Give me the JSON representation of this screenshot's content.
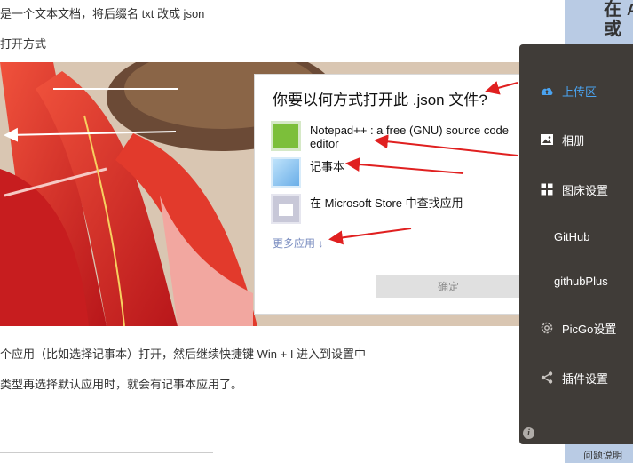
{
  "document": {
    "line1": "是一个文本文档，将后缀名 txt 改成 json",
    "line2": "打开方式",
    "line3": "个应用（比如选择记事本）打开，然后继续快捷键 Win + I 进入到设置中",
    "line4": "类型再选择默认应用时，就会有记事本应用了。"
  },
  "dialog": {
    "title": "你要以何方式打开此 .json 文件?",
    "apps": [
      {
        "name": "Notepad++ : a free (GNU) source code editor",
        "icon": "notepad-plus-plus-icon"
      },
      {
        "name": "记事本",
        "icon": "notepad-icon"
      },
      {
        "name": "在 Microsoft Store 中查找应用",
        "icon": "microsoft-store-icon"
      }
    ],
    "more_apps": "更多应用 ↓",
    "ok_button": "确定"
  },
  "sidebar": {
    "items": [
      {
        "label": "上传区",
        "icon": "cloud-upload-icon",
        "active": true
      },
      {
        "label": "相册",
        "icon": "image-icon"
      },
      {
        "label": "图床设置",
        "icon": "grid-icon"
      },
      {
        "label": "GitHub"
      },
      {
        "label": "githubPlus"
      },
      {
        "label": "PicGo设置",
        "icon": "gear-icon"
      },
      {
        "label": "插件设置",
        "icon": "share-icon"
      }
    ],
    "info_icon": "i"
  },
  "right_page": {
    "text_col1": "在或",
    "text_col2": "AI",
    "help_link": "问题说明"
  },
  "colors": {
    "sidebar_bg": "#403c38",
    "active_item": "#4aa3f0",
    "annotation_arrow": "#e02020"
  }
}
